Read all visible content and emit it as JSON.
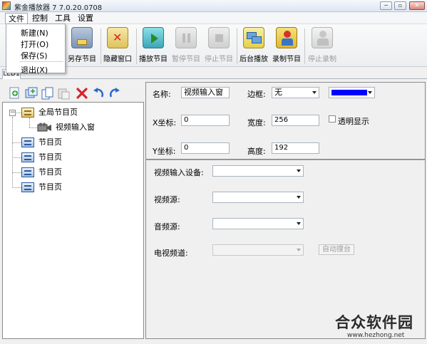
{
  "window": {
    "title": "紫金播放器 7 7.0.20.0708",
    "controls": {
      "minimize": "─",
      "maximize": "▫",
      "close": "✕"
    }
  },
  "menubar": {
    "items": [
      "文件",
      "控制",
      "工具",
      "设置"
    ]
  },
  "file_menu": {
    "items": [
      "新建(N)",
      "打开(O)",
      "保存(S)",
      "退出(X)"
    ]
  },
  "toolbar": {
    "buttons": [
      {
        "label": "另存节目",
        "icon": "save-as-icon",
        "enabled": true
      },
      {
        "label": "隐藏窗口",
        "icon": "hide-window-icon",
        "enabled": true
      },
      {
        "label": "播放节目",
        "icon": "play-icon",
        "enabled": true
      },
      {
        "label": "暂停节目",
        "icon": "pause-icon",
        "enabled": false
      },
      {
        "label": "停止节目",
        "icon": "stop-icon",
        "enabled": false
      },
      {
        "label": "后台播放",
        "icon": "background-play-icon",
        "enabled": true
      },
      {
        "label": "录制节目",
        "icon": "record-icon",
        "enabled": true
      },
      {
        "label": "停止录制",
        "icon": "stop-record-icon",
        "enabled": false
      }
    ]
  },
  "tabs": [
    "LED1"
  ],
  "tree": {
    "root": "全局节目页",
    "root_child": "视频输入窗",
    "pages": [
      "节目页",
      "节目页",
      "节目页",
      "节目页"
    ]
  },
  "props": {
    "name_label": "名称:",
    "name_value": "视频输入窗",
    "border_label": "边框:",
    "border_value": "无",
    "x_label": "X坐标:",
    "x_value": "0",
    "width_label": "宽度:",
    "width_value": "256",
    "transparent_label": "透明显示",
    "y_label": "Y坐标:",
    "y_value": "0",
    "height_label": "高度:",
    "height_value": "192",
    "border_color": "#0000ff"
  },
  "video": {
    "device_label": "视频输入设备:",
    "source_label": "视频源:",
    "audio_label": "音频源:",
    "tv_label": "电视频道:",
    "auto_search": "自动搜台"
  },
  "watermark": {
    "logo": "合众软件园",
    "url": "www.hezhong.net"
  }
}
